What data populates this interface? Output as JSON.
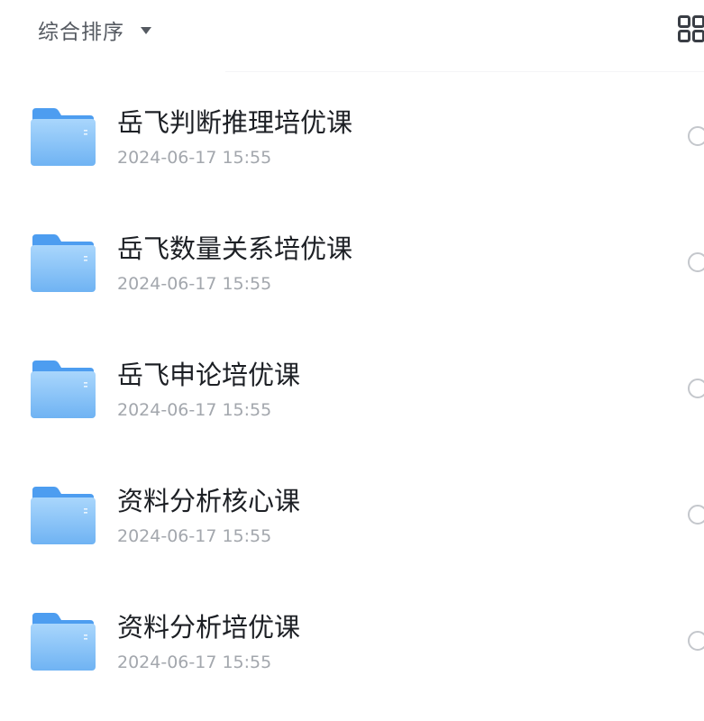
{
  "toolbar": {
    "sort_label": "综合排序",
    "sort_icon": "caret-down-icon",
    "view_icon": "grid-view-icon"
  },
  "colors": {
    "folder_top": "#9fd0fb",
    "folder_bottom": "#6fb5f4",
    "text_primary": "#1c1f24",
    "text_secondary": "#a3a7ad"
  },
  "folders": [
    {
      "name": "岳飞判断推理培优课",
      "date": "2024-06-17 15:55",
      "icon": "folder-icon"
    },
    {
      "name": "岳飞数量关系培优课",
      "date": "2024-06-17 15:55",
      "icon": "folder-icon"
    },
    {
      "name": "岳飞申论培优课",
      "date": "2024-06-17 15:55",
      "icon": "folder-icon"
    },
    {
      "name": "资料分析核心课",
      "date": "2024-06-17 15:55",
      "icon": "folder-icon"
    },
    {
      "name": "资料分析培优课",
      "date": "2024-06-17 15:55",
      "icon": "folder-icon"
    }
  ]
}
